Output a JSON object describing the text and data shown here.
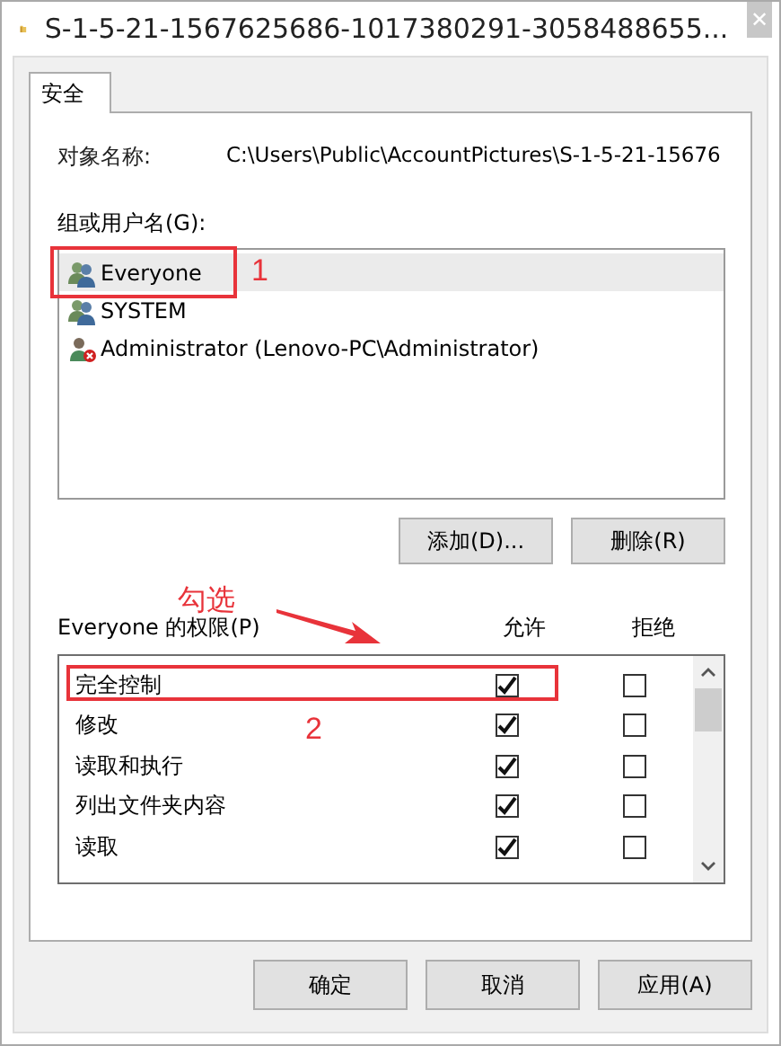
{
  "window": {
    "title": "S-1-5-21-1567625686-1017380291-3058488655...",
    "close": "✕"
  },
  "tabs": [
    {
      "label": "安全",
      "selected": true
    }
  ],
  "object_name": {
    "label": "对象名称:",
    "value": "C:\\Users\\Public\\AccountPictures\\S-1-5-21-15676"
  },
  "groups": {
    "label": "组或用户名(G):",
    "items": [
      {
        "name": "Everyone",
        "kind": "group",
        "selected": true,
        "annotation": "1"
      },
      {
        "name": "SYSTEM",
        "kind": "group",
        "selected": false
      },
      {
        "name": "Administrator (Lenovo-PC\\Administrator)",
        "kind": "user-denied",
        "selected": false
      }
    ]
  },
  "group_buttons": [
    "添加(D)...",
    "删除(R)"
  ],
  "check_hint": "勾选",
  "permissions": {
    "label": "Everyone 的权限(P)",
    "allow_header": "允许",
    "deny_header": "拒绝",
    "annotation": "2",
    "rows": [
      {
        "name": "完全控制",
        "allow": true,
        "deny": false,
        "highlighted": true
      },
      {
        "name": "修改",
        "allow": true,
        "deny": false,
        "highlighted": false
      },
      {
        "name": "读取和执行",
        "allow": true,
        "deny": false,
        "highlighted": false
      },
      {
        "name": "列出文件夹内容",
        "allow": true,
        "deny": false,
        "highlighted": false
      },
      {
        "name": "读取",
        "allow": true,
        "deny": false,
        "highlighted": false
      }
    ]
  },
  "buttons": [
    "确定",
    "取消",
    "应用(A)"
  ]
}
